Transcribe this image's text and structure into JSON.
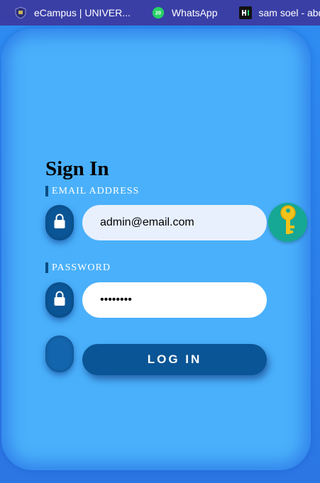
{
  "bookmarks": [
    {
      "label": "eCampus | UNIVER...",
      "icon": "university-crest-icon"
    },
    {
      "label": "WhatsApp",
      "icon": "whatsapp-icon",
      "badge": "20"
    },
    {
      "label": "sam soel - abd",
      "icon": "hashnode-icon"
    }
  ],
  "form": {
    "title": "Sign In",
    "email_label": "EMAIL ADDRESS",
    "email_value": "admin@email.com",
    "password_label": "PASSWORD",
    "password_value": "secretpw",
    "login_label": "LOG IN"
  },
  "colors": {
    "bookmarks_bar": "#3a3fa6",
    "card": "#4ab0fb",
    "accent_dark": "#0a5596",
    "key_badge": "#16a894"
  }
}
